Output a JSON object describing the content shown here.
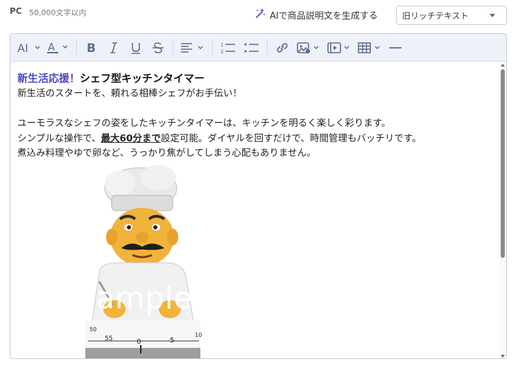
{
  "header": {
    "device_label": "PC",
    "char_limit": "50,000文字以内",
    "ai_generate_label": "AIで商品説明文を生成する",
    "format_select": {
      "selected": "旧リッチテキスト"
    }
  },
  "toolbar": {
    "icons": [
      "font-size-icon",
      "font-color-icon",
      "bold-icon",
      "italic-icon",
      "underline-icon",
      "strikethrough-icon",
      "align-icon",
      "ordered-list-icon",
      "bullet-list-icon",
      "link-icon",
      "image-icon",
      "video-icon",
      "table-icon",
      "horizontal-rule-icon"
    ],
    "accent_color": "#5a6b8c"
  },
  "content": {
    "headline_accent": "新生活応援！",
    "headline_main": "シェフ型キッチンタイマー",
    "line1": "新生活のスタートを、頼れる相棒シェフがお手伝い！",
    "line2": "ユーモラスなシェフの姿をしたキッチンタイマーは、キッチンを明るく楽しく彩ります。",
    "line3_pre": "シンプルな操作で、",
    "line3_bold": "最大60分まで",
    "line3_post": "設定可能。ダイヤルを回すだけで、時間管理もバッチリです。",
    "line4": "煮込み料理やゆで卵など、うっかり焦がしてしまう心配もありません。",
    "image_watermark": "sample",
    "dial_numbers": [
      "50",
      "55",
      "0",
      "5",
      "10"
    ],
    "headline_color": "#4a47c4"
  }
}
